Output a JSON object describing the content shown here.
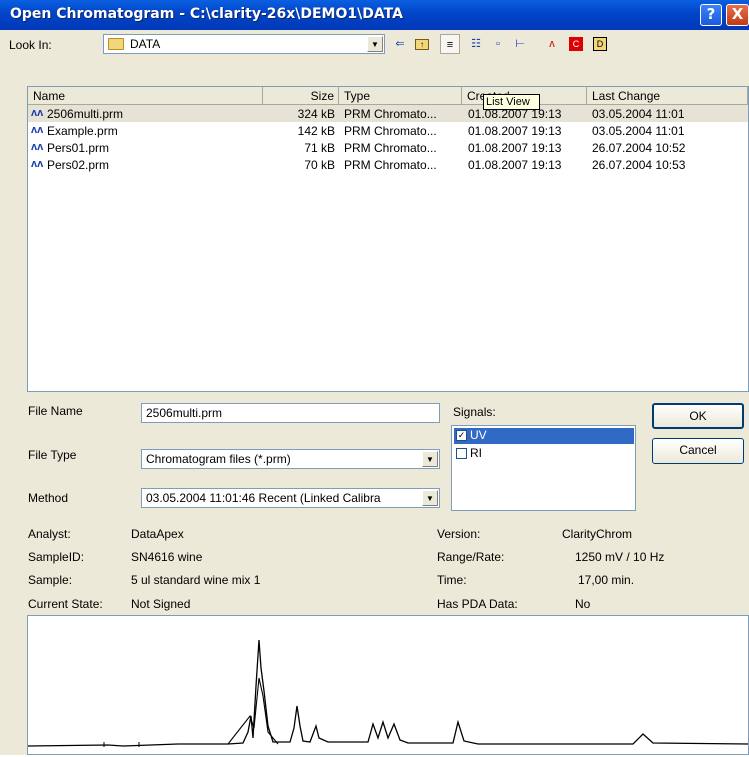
{
  "window": {
    "title": "Open Chromatogram - C:\\clarity-26x\\DEMO1\\DATA",
    "help": "?",
    "close": "X"
  },
  "lookin": {
    "label": "Look In:",
    "value": "DATA"
  },
  "toolbar": {
    "icons": [
      "back-arrow-icon",
      "up-folder-icon",
      "details-view-icon",
      "list-view-icon",
      "small-icons-icon",
      "tree-view-icon",
      "chromatogram-icon",
      "calibration-icon",
      "data-icon"
    ]
  },
  "tooltip": "List View",
  "table": {
    "columns": [
      "Name",
      "Size",
      "Type",
      "Created",
      "Last Change"
    ],
    "rows": [
      {
        "name": "2506multi.prm",
        "size": "324 kB",
        "type": "PRM Chromato...",
        "created": "01.08.2007 19:13",
        "changed": "03.05.2004 11:01"
      },
      {
        "name": "Example.prm",
        "size": "142 kB",
        "type": "PRM Chromato...",
        "created": "01.08.2007 19:13",
        "changed": "03.05.2004 11:01"
      },
      {
        "name": "Pers01.prm",
        "size": "71 kB",
        "type": "PRM Chromato...",
        "created": "01.08.2007 19:13",
        "changed": "26.07.2004 10:52"
      },
      {
        "name": "Pers02.prm",
        "size": "70 kB",
        "type": "PRM Chromato...",
        "created": "01.08.2007 19:13",
        "changed": "26.07.2004 10:53"
      }
    ]
  },
  "form": {
    "file_name_label": "File Name",
    "file_name": "2506multi.prm",
    "file_type_label": "File Type",
    "file_type": "Chromatogram files (*.prm)",
    "method_label": "Method",
    "method": "03.05.2004 11:01:46 Recent (Linked Calibra"
  },
  "signals": {
    "label": "Signals:",
    "items": [
      {
        "name": "UV",
        "checked": true
      },
      {
        "name": "RI",
        "checked": false
      }
    ]
  },
  "buttons": {
    "ok": "OK",
    "cancel": "Cancel"
  },
  "info": {
    "analyst_label": "Analyst:",
    "analyst": "DataApex",
    "sampleid_label": "SampleID:",
    "sampleid": "SN4616 wine",
    "sample_label": "Sample:",
    "sample": "5 ul standard wine mix 1",
    "state_label": "Current State:",
    "state": "Not Signed",
    "version_label": "Version:",
    "version": "ClarityChrom",
    "range_label": "Range/Rate:",
    "range": "1250 mV / 10 Hz",
    "time_label": "Time:",
    "time": "17,00 min.",
    "pda_label": "Has PDA Data:",
    "pda": "No"
  }
}
